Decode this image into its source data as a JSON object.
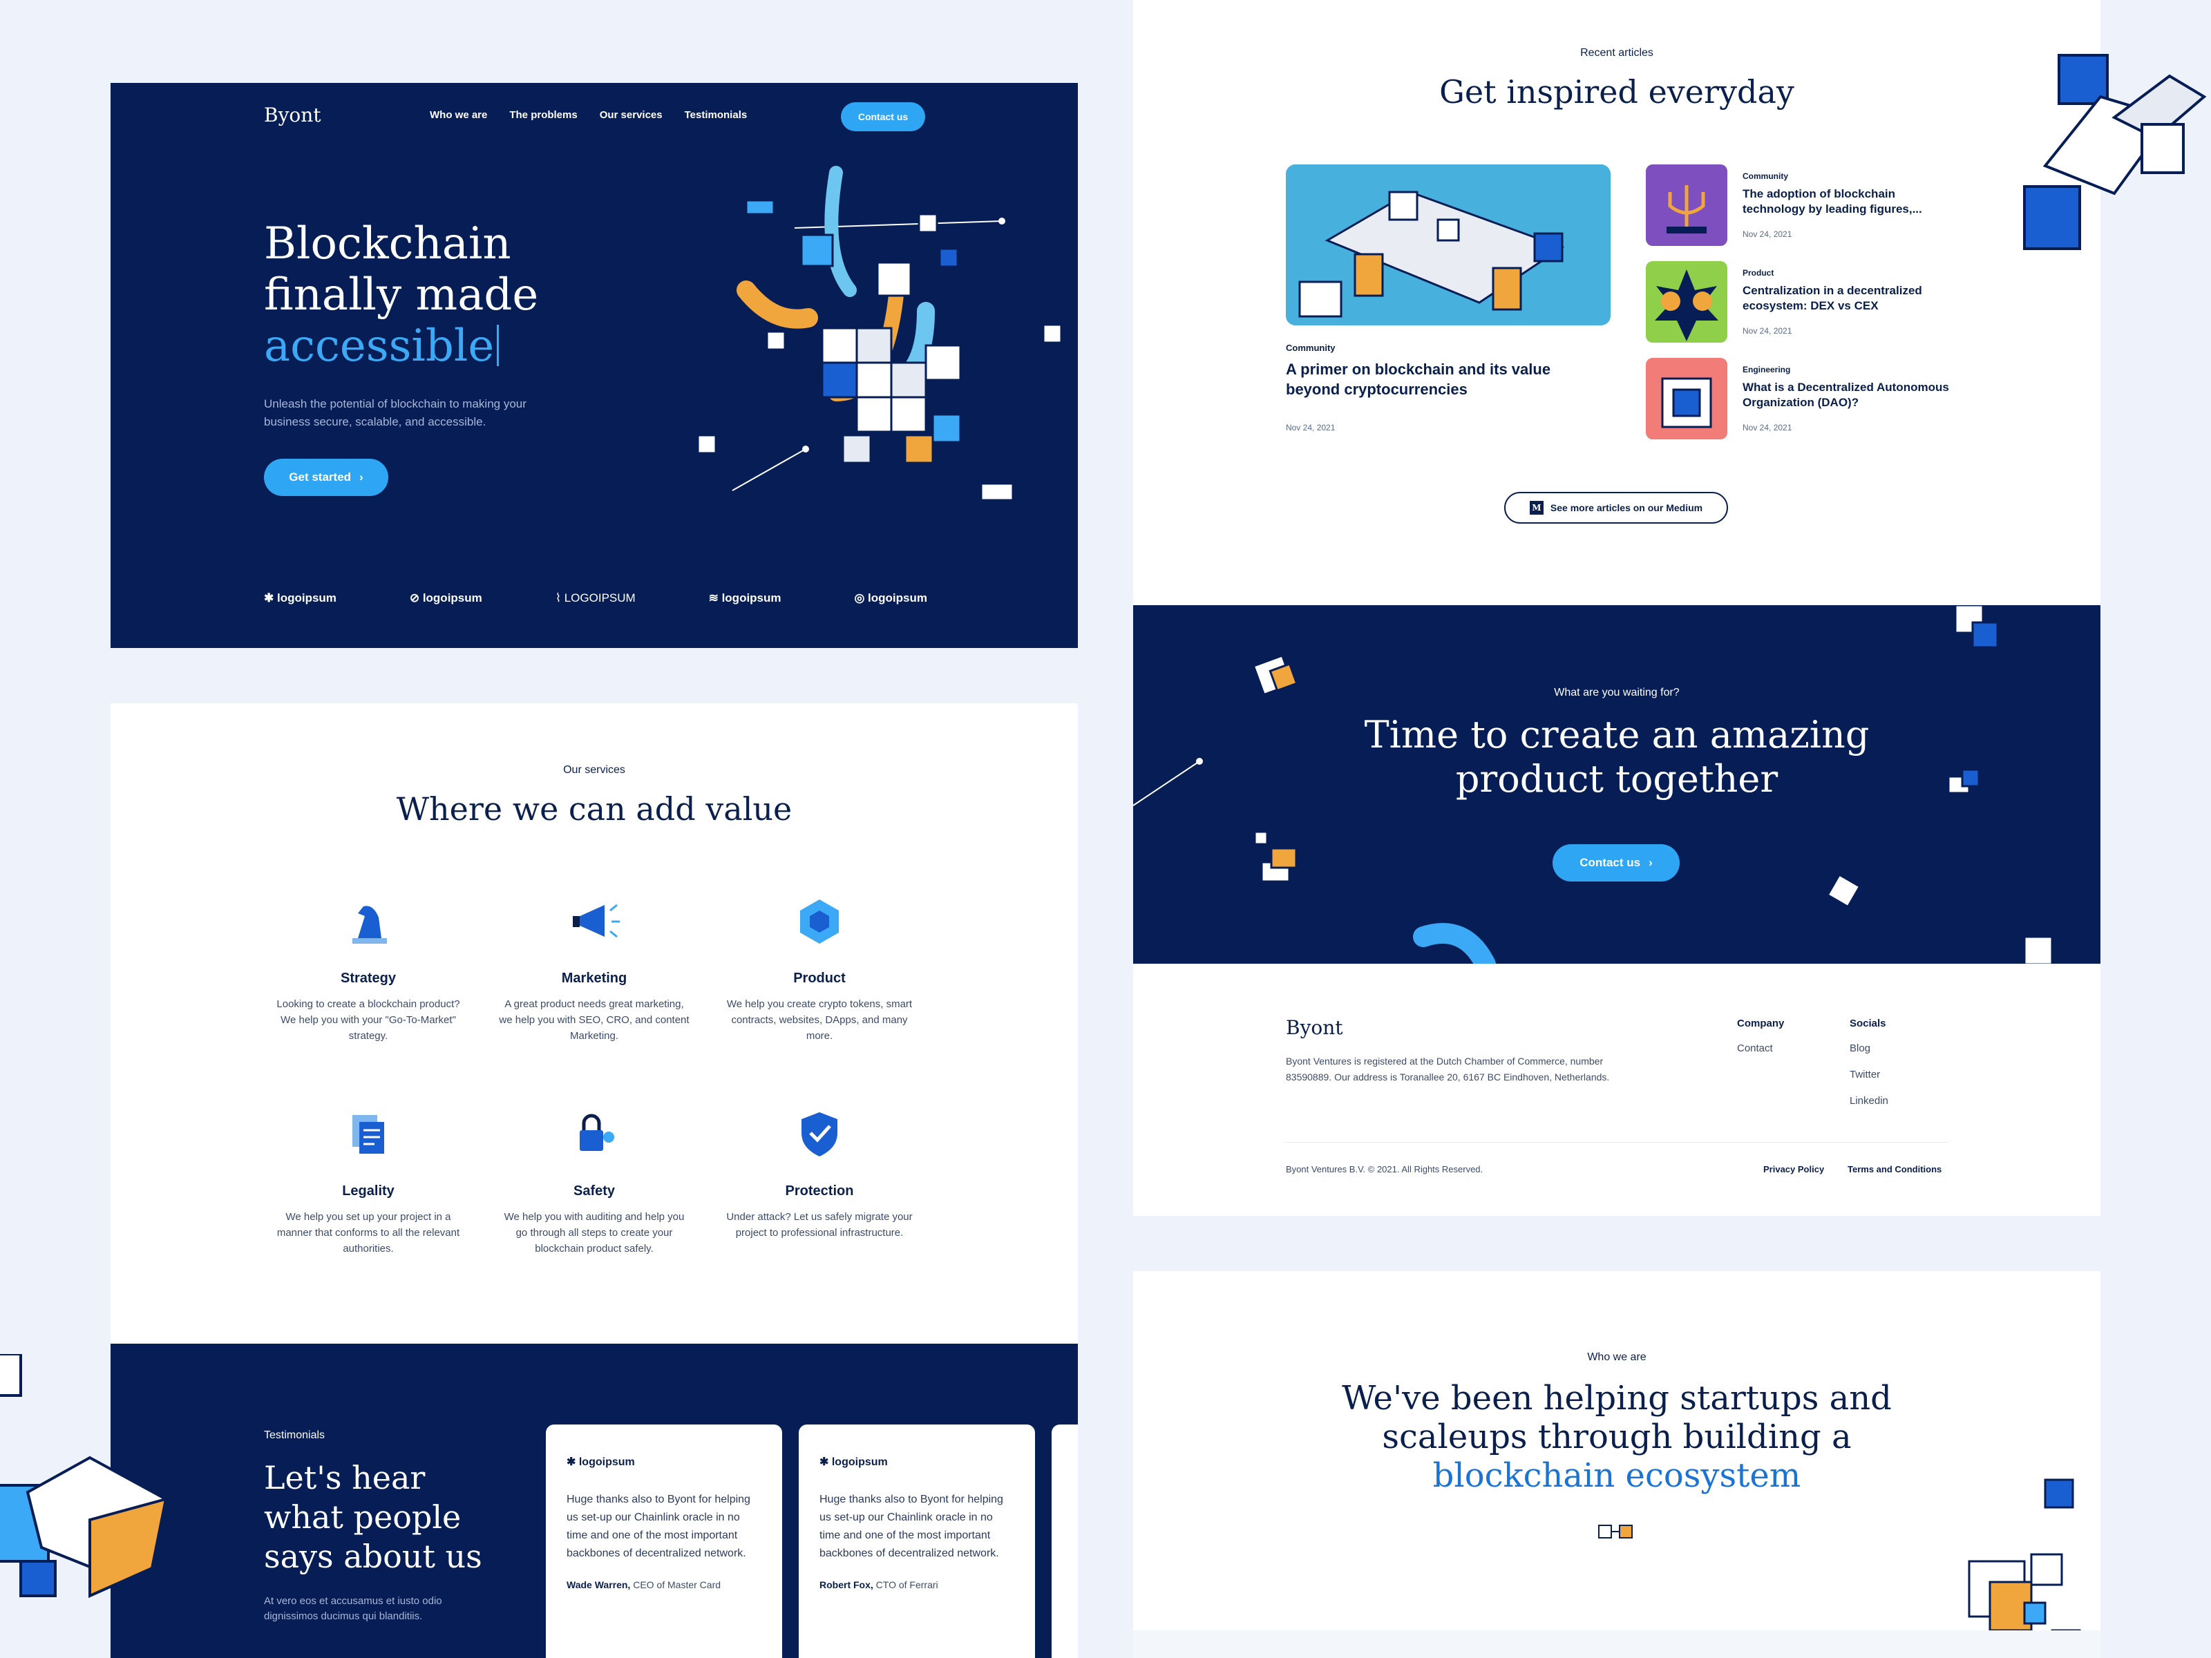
{
  "hero": {
    "brand": "Byont",
    "nav": [
      "Who we are",
      "The problems",
      "Our services",
      "Testimonials"
    ],
    "contact_label": "Contact us",
    "title_line1": "Blockchain",
    "title_line2": "finally made",
    "title_accent": "accessible",
    "subtitle": "Unleash the potential of blockchain to making your business secure, scalable, and  accessible.",
    "cta_label": "Get started",
    "logos": [
      "logoipsum",
      "logoipsum",
      "LOGOIPSUM",
      "logoipsum",
      "logoipsum"
    ]
  },
  "services": {
    "eyebrow": "Our services",
    "title": "Where we can add value",
    "items": [
      {
        "title": "Strategy",
        "text": "Looking to create a blockchain product? We help you with your \"Go-To-Market\" strategy.",
        "icon": "chess-knight-icon"
      },
      {
        "title": "Marketing",
        "text": "A great product needs great marketing, we help you with SEO, CRO, and content Marketing.",
        "icon": "megaphone-icon"
      },
      {
        "title": "Product",
        "text": "We help you create crypto tokens, smart contracts, websites, DApps, and many more.",
        "icon": "cube-icon"
      },
      {
        "title": "Legality",
        "text": "We help you set up your project in a manner that conforms to all the relevant authorities.",
        "icon": "documents-icon"
      },
      {
        "title": "Safety",
        "text": "We help you with auditing and help you go through all steps to create your blockchain product safely.",
        "icon": "lock-key-icon"
      },
      {
        "title": "Protection",
        "text": "Under attack? Let us safely migrate your project to professional infrastructure.",
        "icon": "shield-icon"
      }
    ]
  },
  "testimonials": {
    "eyebrow": "Testimonials",
    "title_line1": "Let's hear",
    "title_line2": "what people",
    "title_line3": "says about us",
    "subtitle": "At vero eos et accusamus et iusto odio dignissimos ducimus qui blanditiis.",
    "cards": [
      {
        "logo": "logoipsum",
        "quote": "Huge thanks also to Byont for helping us set-up our Chainlink oracle in no time and one of the most important backbones of decentralized network.",
        "name": "Wade Warren,",
        "role": "CEO of Master Card"
      },
      {
        "logo": "logoipsum",
        "quote": "Huge thanks also to Byont for helping us set-up our Chainlink oracle in no time and one of the most important backbones of decentralized network.",
        "name": "Robert Fox,",
        "role": "CTO of Ferrari"
      }
    ]
  },
  "articles": {
    "eyebrow": "Recent articles",
    "title": "Get inspired everyday",
    "featured": {
      "category": "Community",
      "title": "A primer on blockchain and its value beyond cryptocurrencies",
      "date": "Nov 24, 2021"
    },
    "list": [
      {
        "category": "Community",
        "title": "The adoption of blockchain technology by leading figures,...",
        "date": "Nov 24, 2021"
      },
      {
        "category": "Product",
        "title": "Centralization in a decentralized ecosystem: DEX vs CEX",
        "date": "Nov 24, 2021"
      },
      {
        "category": "Engineering",
        "title": "What is a Decentralized Autonomous Organization (DAO)?",
        "date": "Nov 24, 2021"
      }
    ],
    "more_label": "See more articles on our Medium",
    "medium_glyph": "M"
  },
  "cta": {
    "eyebrow": "What are you waiting for?",
    "title_line1": "Time to create an amazing",
    "title_line2": "product together",
    "button": "Contact us"
  },
  "footer": {
    "brand": "Byont",
    "address": "Byont Ventures is registered at the Dutch Chamber of Commerce, number 83590889. Our address is Toranallee 20, 6167 BC Eindhoven, Netherlands.",
    "company_heading": "Company",
    "company_links": [
      "Contact"
    ],
    "socials_heading": "Socials",
    "social_links": [
      "Blog",
      "Twitter",
      "Linkedin"
    ],
    "copyright": "Byont Ventures B.V. © 2021. All Rights Reserved.",
    "privacy": "Privacy Policy",
    "terms": "Terms and Conditions"
  },
  "who": {
    "eyebrow": "Who we are",
    "title_line1": "We've been helping startups and",
    "title_line2": "scaleups through building a",
    "title_accent": "blockchain ecosystem"
  },
  "colors": {
    "navy": "#061d56",
    "accent": "#2ea6f4",
    "ink": "#0b1f4d",
    "orange": "#f0a63c"
  }
}
